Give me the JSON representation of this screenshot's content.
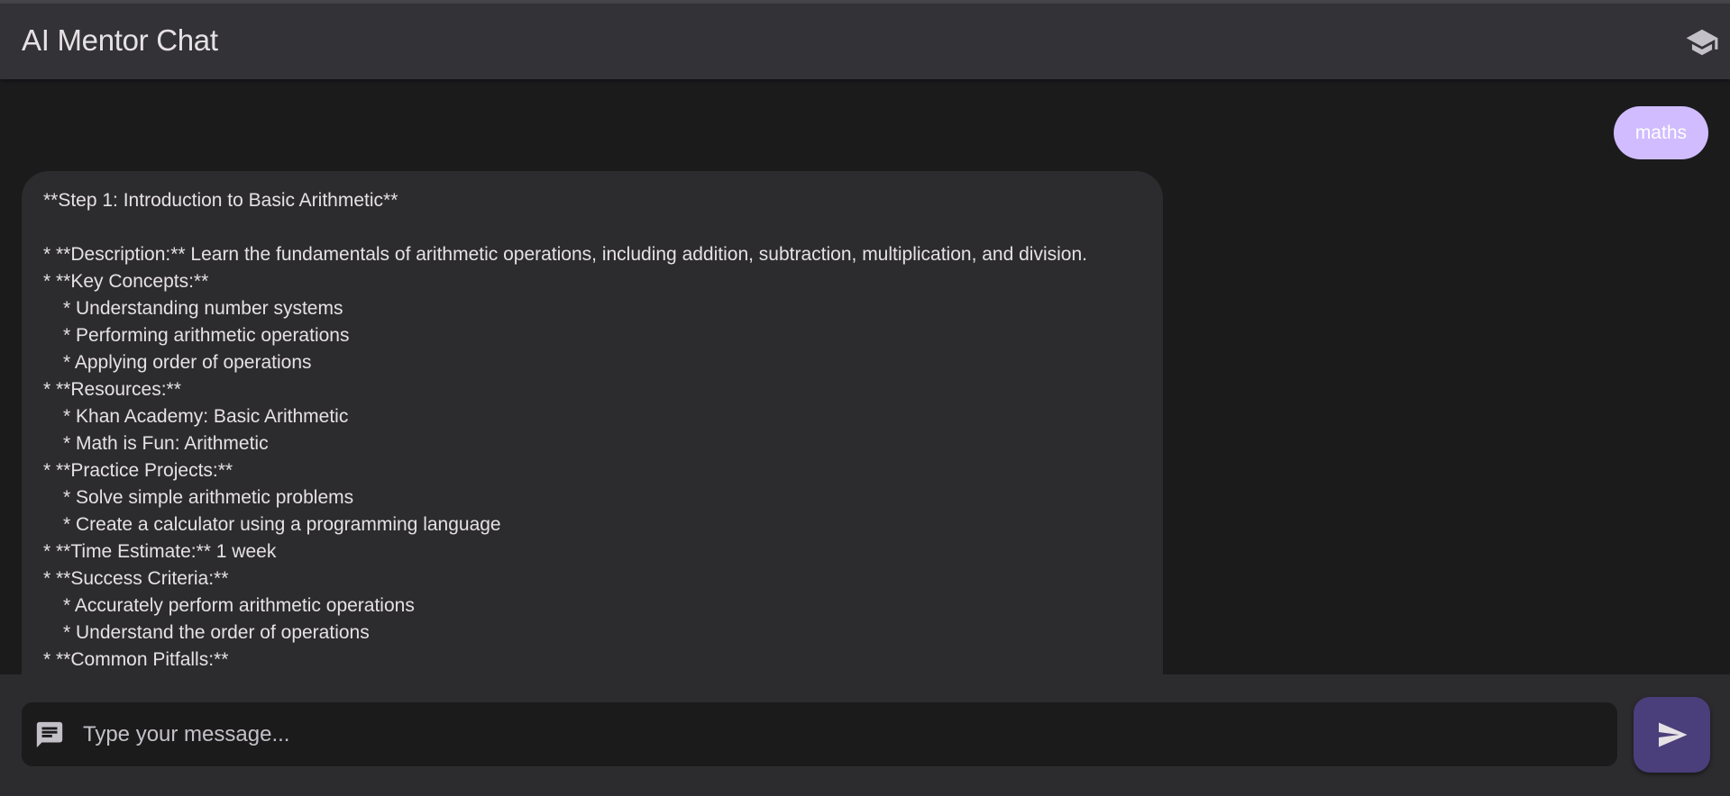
{
  "header": {
    "title": "AI Mentor Chat",
    "icon": "graduation-cap-icon"
  },
  "colors": {
    "user_bubble": "#d0bcff",
    "assistant_bubble": "#2c2c2f",
    "header_bg": "#333236",
    "send_button": "#4a3f7a",
    "background": "#1b1b1c"
  },
  "messages": {
    "user": {
      "text": "maths"
    },
    "assistant": {
      "lines": [
        "**Step 1: Introduction to Basic Arithmetic**",
        "",
        "* **Description:** Learn the fundamentals of arithmetic operations, including addition, subtraction, multiplication, and division.",
        "* **Key Concepts:**",
        "* Understanding number systems",
        "* Performing arithmetic operations",
        "* Applying order of operations",
        "* **Resources:**",
        "* Khan Academy: Basic Arithmetic",
        "* Math is Fun: Arithmetic",
        "* **Practice Projects:**",
        "* Solve simple arithmetic problems",
        "* Create a calculator using a programming language",
        "* **Time Estimate:** 1 week",
        "* **Success Criteria:**",
        "* Accurately perform arithmetic operations",
        "* Understand the order of operations",
        "* **Common Pitfalls:**"
      ]
    }
  },
  "composer": {
    "placeholder": "Type your message...",
    "value": "",
    "input_icon": "message-icon",
    "send_icon": "send-icon"
  }
}
